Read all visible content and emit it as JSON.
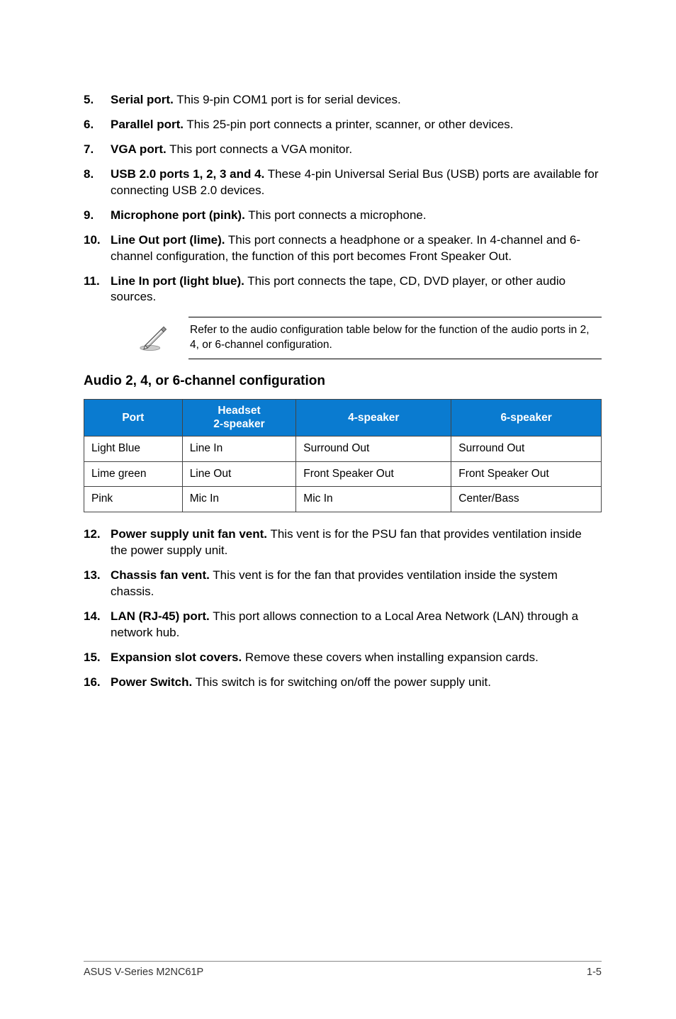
{
  "items_top": [
    {
      "num": "5.",
      "bold": "Serial port.",
      "rest": " This 9-pin COM1 port is for serial devices."
    },
    {
      "num": "6.",
      "bold": "Parallel port.",
      "rest": " This 25-pin port connects a printer, scanner, or other devices."
    },
    {
      "num": "7.",
      "bold": "VGA port.",
      "rest": " This port connects a VGA monitor."
    },
    {
      "num": "8.",
      "bold": "USB 2.0 ports 1, 2, 3 and 4.",
      "rest": " These 4-pin Universal Serial Bus (USB) ports are available for connecting USB 2.0 devices."
    },
    {
      "num": "9.",
      "bold": "Microphone port (pink).",
      "rest": " This port connects a microphone."
    },
    {
      "num": "10.",
      "bold": "Line Out port (lime).",
      "rest": " This port connects a headphone or a speaker. In 4-channel and 6-channel configuration, the function of this port becomes Front Speaker Out."
    },
    {
      "num": "11.",
      "bold": "Line In port (light blue).",
      "rest": " This port connects the tape, CD, DVD player, or other audio sources."
    }
  ],
  "note": "Refer to the audio configuration table below for the function of the audio ports in 2, 4, or 6-channel configuration.",
  "section_heading": "Audio 2, 4, or 6-channel configuration",
  "table": {
    "headers": [
      "Port",
      "Headset\n2-speaker",
      "4-speaker",
      "6-speaker"
    ],
    "rows": [
      [
        "Light Blue",
        "Line In",
        "Surround Out",
        "Surround Out"
      ],
      [
        "Lime green",
        "Line Out",
        "Front Speaker Out",
        "Front Speaker Out"
      ],
      [
        "Pink",
        "Mic In",
        "Mic In",
        "Center/Bass"
      ]
    ]
  },
  "items_bottom": [
    {
      "num": "12.",
      "bold": "Power supply unit fan vent.",
      "rest": " This vent is for the PSU fan that provides ventilation inside the power supply unit."
    },
    {
      "num": "13.",
      "bold": "Chassis fan vent.",
      "rest": " This vent is for the fan that provides ventilation inside the system chassis."
    },
    {
      "num": "14.",
      "bold": "LAN (RJ-45) port.",
      "rest": " This port allows connection to a Local Area Network (LAN) through a network hub."
    },
    {
      "num": "15.",
      "bold": "Expansion slot covers.",
      "rest": " Remove these covers when installing expansion cards."
    },
    {
      "num": "16.",
      "bold": "Power Switch.",
      "rest": " This switch is for switching on/off the power supply unit."
    }
  ],
  "footer": {
    "left": "ASUS V-Series M2NC61P",
    "right": "1-5"
  }
}
